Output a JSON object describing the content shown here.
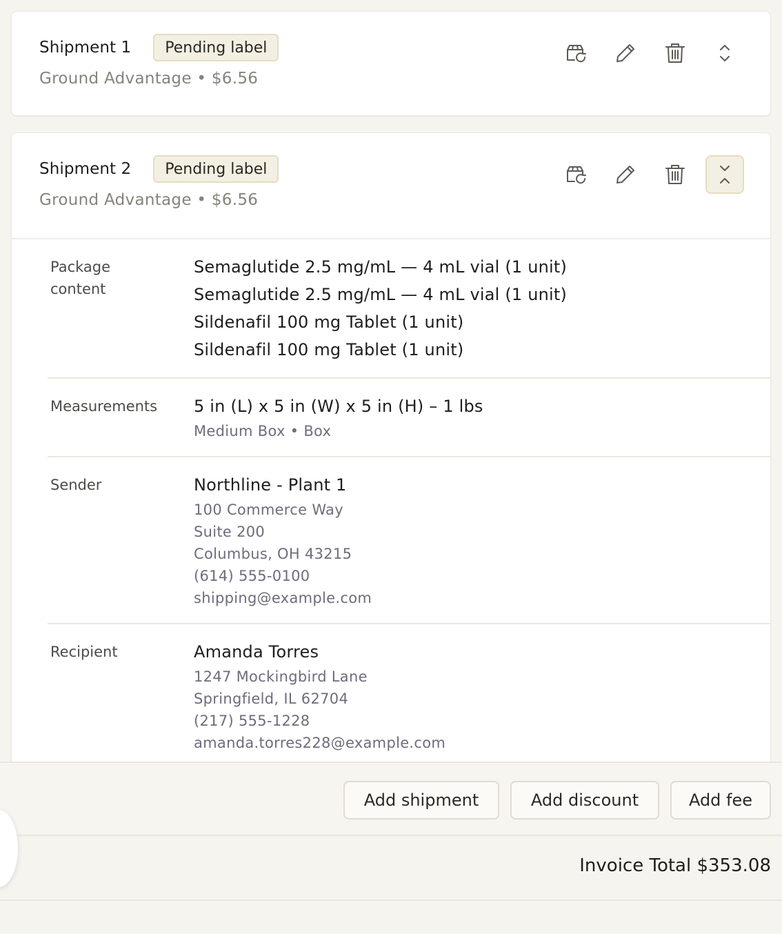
{
  "shipments": [
    {
      "title": "Shipment 1",
      "badge": "Pending label",
      "subtitle": "Ground Advantage • $6.56",
      "expanded": false
    },
    {
      "title": "Shipment 2",
      "badge": "Pending label",
      "subtitle": "Ground Advantage • $6.56",
      "expanded": true,
      "details": {
        "package_label": "Package content",
        "package_items": [
          "Semaglutide 2.5 mg/mL — 4 mL vial (1 unit)",
          "Semaglutide 2.5 mg/mL — 4 mL vial (1 unit)",
          "Sildenafil 100 mg Tablet (1 unit)",
          "Sildenafil 100 mg Tablet (1 unit)"
        ],
        "measurements_label": "Measurements",
        "measurements_main": "5 in (L) x 5 in (W) x 5 in (H) – 1 lbs",
        "measurements_sub": "Medium Box • Box",
        "sender_label": "Sender",
        "sender_name": "Northline - Plant 1",
        "sender_lines": [
          "100 Commerce Way",
          "Suite 200",
          "Columbus, OH 43215",
          "(614) 555-0100",
          "shipping@example.com"
        ],
        "recipient_label": "Recipient",
        "recipient_name": "Amanda Torres",
        "recipient_lines": [
          "1247 Mockingbird Lane",
          "Springfield, IL 62704",
          "(217) 555-1228",
          "amanda.torres228@example.com"
        ]
      }
    }
  ],
  "icons": {
    "refresh_label": "package-refresh-icon",
    "edit": "pencil-icon",
    "delete": "trash-icon",
    "expand": "chevron-up-down-icon",
    "collapse": "chevron-collapse-icon"
  },
  "footer": {
    "add_shipment": "Add shipment",
    "add_discount": "Add discount",
    "add_fee": "Add fee"
  },
  "total": {
    "text": "Invoice Total $353.08"
  },
  "colors": {
    "badge_bg": "#f3efe2",
    "badge_border": "#e6dcc0",
    "muted": "#85837c",
    "page_bg": "#f6f4ef"
  }
}
